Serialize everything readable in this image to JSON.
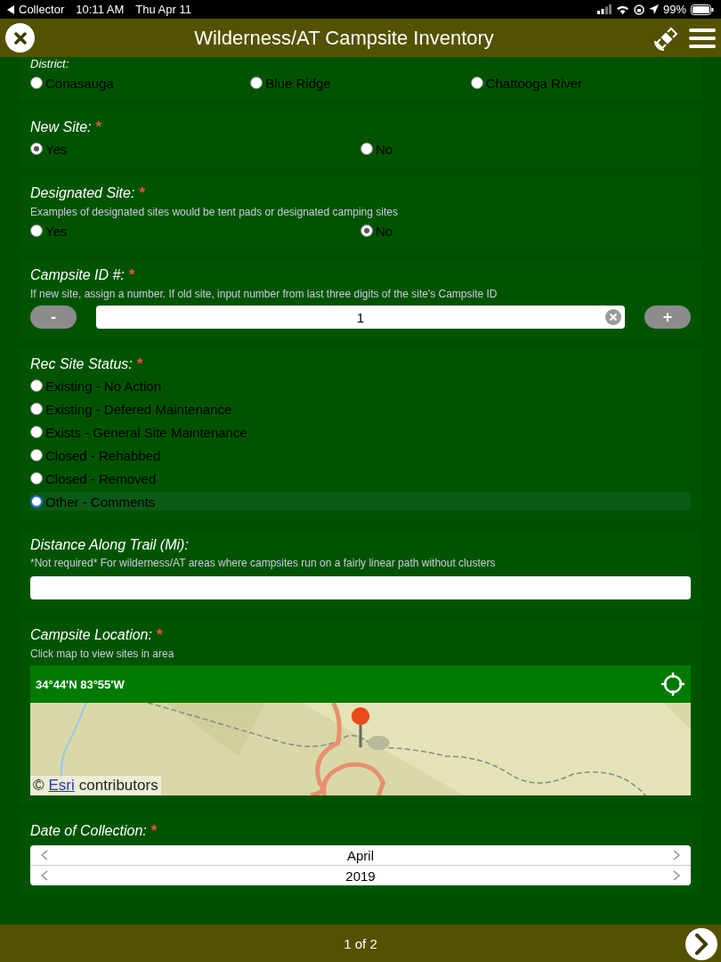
{
  "status_bar": {
    "back_app": "Collector",
    "time": "10:11 AM",
    "date": "Thu Apr 11",
    "battery": "99%"
  },
  "header": {
    "title": "Wilderness/AT Campsite Inventory"
  },
  "fields": [
    {
      "kind": "radio_row",
      "label": "District:",
      "options": [
        {
          "label": "Conasauga",
          "selected": false,
          "focused": false
        },
        {
          "label": "Blue Ridge",
          "selected": false,
          "focused": false
        },
        {
          "label": "Chattooga River",
          "selected": false,
          "focused": false
        }
      ]
    },
    {
      "kind": "radio_row",
      "label": "New Site:",
      "required_mark": "*",
      "options": [
        {
          "label": "Yes",
          "selected": true,
          "focused": false
        },
        {
          "label": "No",
          "selected": false,
          "focused": false
        }
      ]
    },
    {
      "kind": "radio_row",
      "label": "Designated Site:",
      "required_mark": "*",
      "hint": "Examples of designated sites would be tent pads or designated camping sites",
      "options": [
        {
          "label": "Yes",
          "selected": false,
          "focused": false
        },
        {
          "label": "No",
          "selected": true,
          "focused": false
        }
      ]
    },
    {
      "kind": "stepper",
      "label": "Campsite ID #:",
      "required_mark": "*",
      "hint": "If new site, assign a number. If old site, input number from last three digits of the site's Campsite ID",
      "minus": "-",
      "value": "1",
      "plus": "+"
    },
    {
      "kind": "radio_list",
      "label": "Rec Site Status:",
      "required_mark": "*",
      "options": [
        {
          "label": "Existing - No Action",
          "selected": false,
          "focused": false
        },
        {
          "label": "Existing - Defered Maintenance",
          "selected": false,
          "focused": false
        },
        {
          "label": "Exists - General Site Maintenance",
          "selected": false,
          "focused": false
        },
        {
          "label": "Closed - Rehabbed",
          "selected": false,
          "focused": false
        },
        {
          "label": "Closed - Removed",
          "selected": false,
          "focused": false
        },
        {
          "label": "Other - Comments",
          "selected": false,
          "focused": true
        }
      ]
    },
    {
      "kind": "text",
      "label": "Distance Along Trail (Mi):",
      "hint": "*Not required* For wilderness/AT areas where campsites run on a fairly linear path without clusters"
    },
    {
      "kind": "map",
      "label": "Campsite Location:",
      "required_mark": "*",
      "hint": "Click map to view sites in area",
      "coordinates": "34°44'N 83°55'W",
      "attribution_prefix": "©",
      "attribution_link": "Esri",
      "attribution_suffix": "contributors"
    },
    {
      "kind": "date",
      "label": "Date of Collection:",
      "required_mark": "*",
      "month": "April",
      "year": "2019"
    }
  ],
  "footer": {
    "page": "1 of 2"
  }
}
